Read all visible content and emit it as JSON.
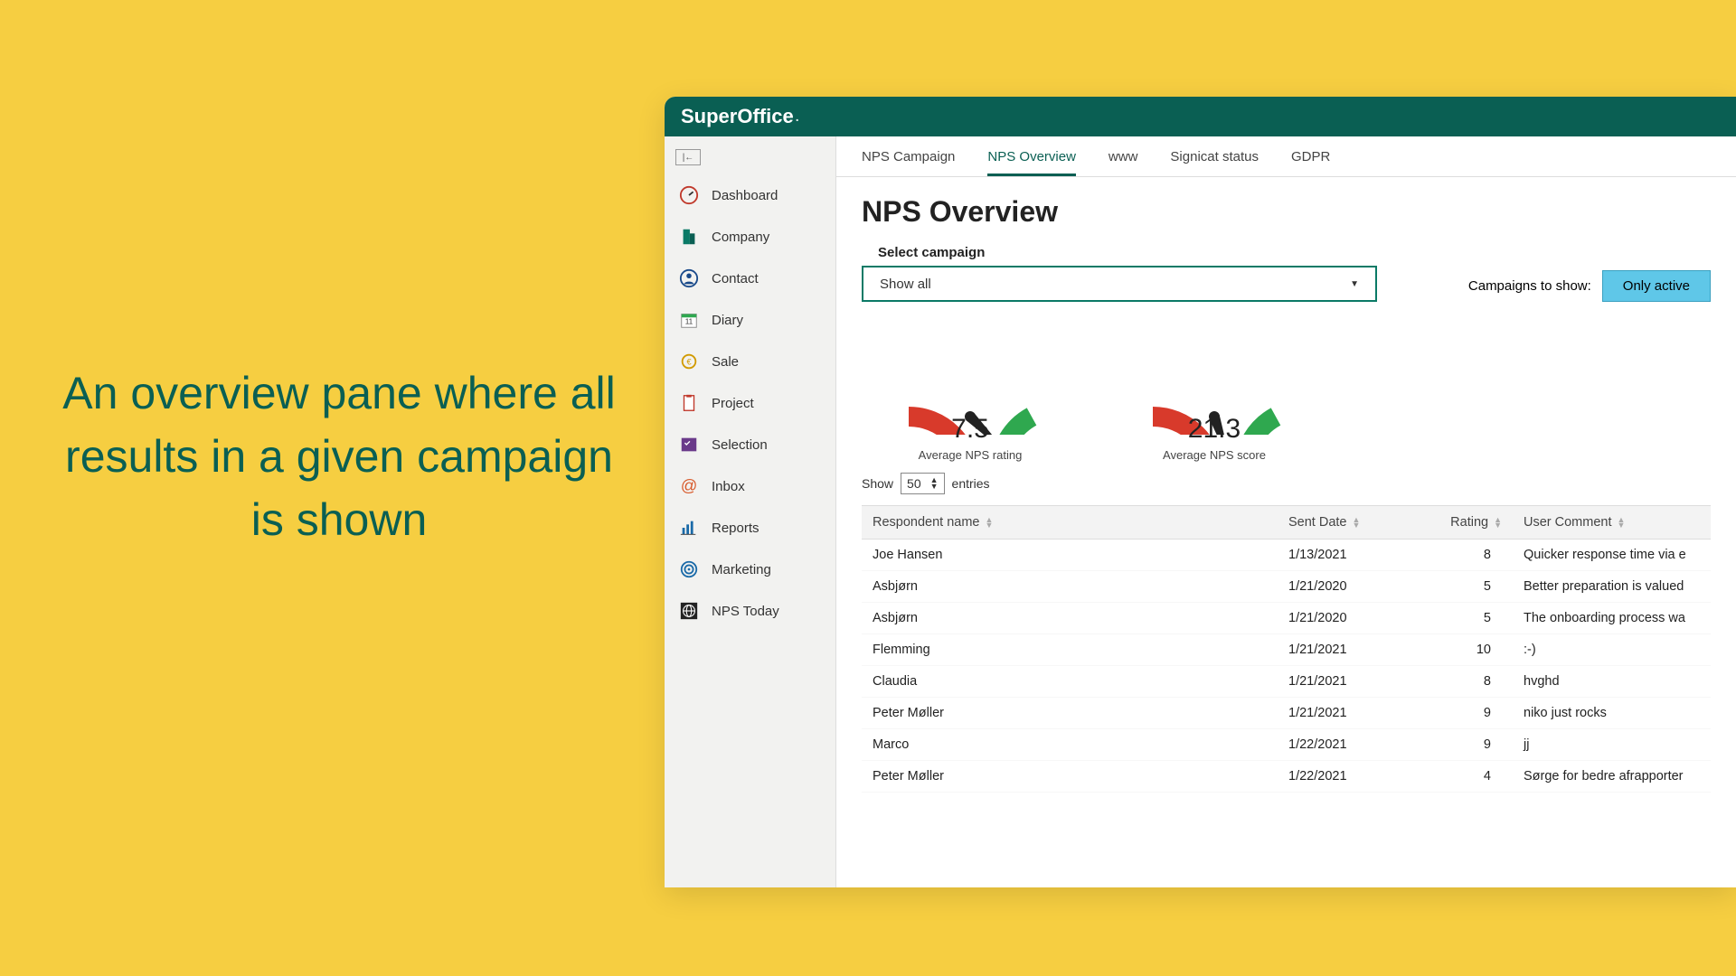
{
  "caption": "An overview pane where all results in a given campaign is shown",
  "brand": "SuperOffice",
  "sidebar": {
    "items": [
      {
        "label": "Dashboard",
        "icon": "gauge"
      },
      {
        "label": "Company",
        "icon": "building"
      },
      {
        "label": "Contact",
        "icon": "person"
      },
      {
        "label": "Diary",
        "icon": "calendar"
      },
      {
        "label": "Sale",
        "icon": "coin"
      },
      {
        "label": "Project",
        "icon": "clipboard"
      },
      {
        "label": "Selection",
        "icon": "checklist"
      },
      {
        "label": "Inbox",
        "icon": "at"
      },
      {
        "label": "Reports",
        "icon": "barchart"
      },
      {
        "label": "Marketing",
        "icon": "target"
      },
      {
        "label": "NPS Today",
        "icon": "globe"
      }
    ]
  },
  "tabs": [
    {
      "label": "NPS Campaign",
      "active": false
    },
    {
      "label": "NPS Overview",
      "active": true
    },
    {
      "label": "www",
      "active": false
    },
    {
      "label": "Signicat status",
      "active": false
    },
    {
      "label": "GDPR",
      "active": false
    }
  ],
  "page": {
    "title": "NPS Overview",
    "select_campaign_label": "Select campaign",
    "select_campaign_value": "Show all",
    "campaigns_to_show_label": "Campaigns to show:",
    "only_active_button": "Only active"
  },
  "gauges": [
    {
      "value": "7.5",
      "label": "Average NPS rating",
      "needle_frac": 0.75
    },
    {
      "value": "21.3",
      "label": "Average NPS score",
      "needle_frac": 0.606
    }
  ],
  "entries": {
    "show_label": "Show",
    "value": "50",
    "suffix": "entries"
  },
  "table": {
    "columns": [
      "Respondent name",
      "Sent Date",
      "Rating",
      "User Comment"
    ],
    "rows": [
      {
        "name": "Joe Hansen",
        "date": "1/13/2021",
        "rating": "8",
        "comment": "Quicker response time via e"
      },
      {
        "name": "Asbjørn",
        "date": "1/21/2020",
        "rating": "5",
        "comment": "Better preparation is valued"
      },
      {
        "name": "Asbjørn",
        "date": "1/21/2020",
        "rating": "5",
        "comment": "The onboarding process wa"
      },
      {
        "name": "Flemming",
        "date": "1/21/2021",
        "rating": "10",
        "comment": ":-)"
      },
      {
        "name": "Claudia",
        "date": "1/21/2021",
        "rating": "8",
        "comment": "hvghd"
      },
      {
        "name": "Peter Møller",
        "date": "1/21/2021",
        "rating": "9",
        "comment": "niko just rocks"
      },
      {
        "name": "Marco",
        "date": "1/22/2021",
        "rating": "9",
        "comment": "jj"
      },
      {
        "name": "Peter Møller",
        "date": "1/22/2021",
        "rating": "4",
        "comment": "Sørge for bedre afrapporter"
      }
    ]
  },
  "chart_data": [
    {
      "type": "gauge",
      "title": "Average NPS rating",
      "value": 7.5,
      "range": [
        0,
        10
      ],
      "segments": [
        {
          "color": "#d83a2b",
          "range": [
            0,
            5
          ]
        },
        {
          "color": "#f4c430",
          "range": [
            5,
            7
          ]
        },
        {
          "color": "#2fa84f",
          "range": [
            7,
            10
          ]
        }
      ]
    },
    {
      "type": "gauge",
      "title": "Average NPS score",
      "value": 21.3,
      "range": [
        -100,
        100
      ],
      "segments": [
        {
          "color": "#d83a2b",
          "range": [
            -100,
            0
          ]
        },
        {
          "color": "#f4c430",
          "range": [
            0,
            30
          ]
        },
        {
          "color": "#2fa84f",
          "range": [
            30,
            100
          ]
        }
      ]
    }
  ]
}
